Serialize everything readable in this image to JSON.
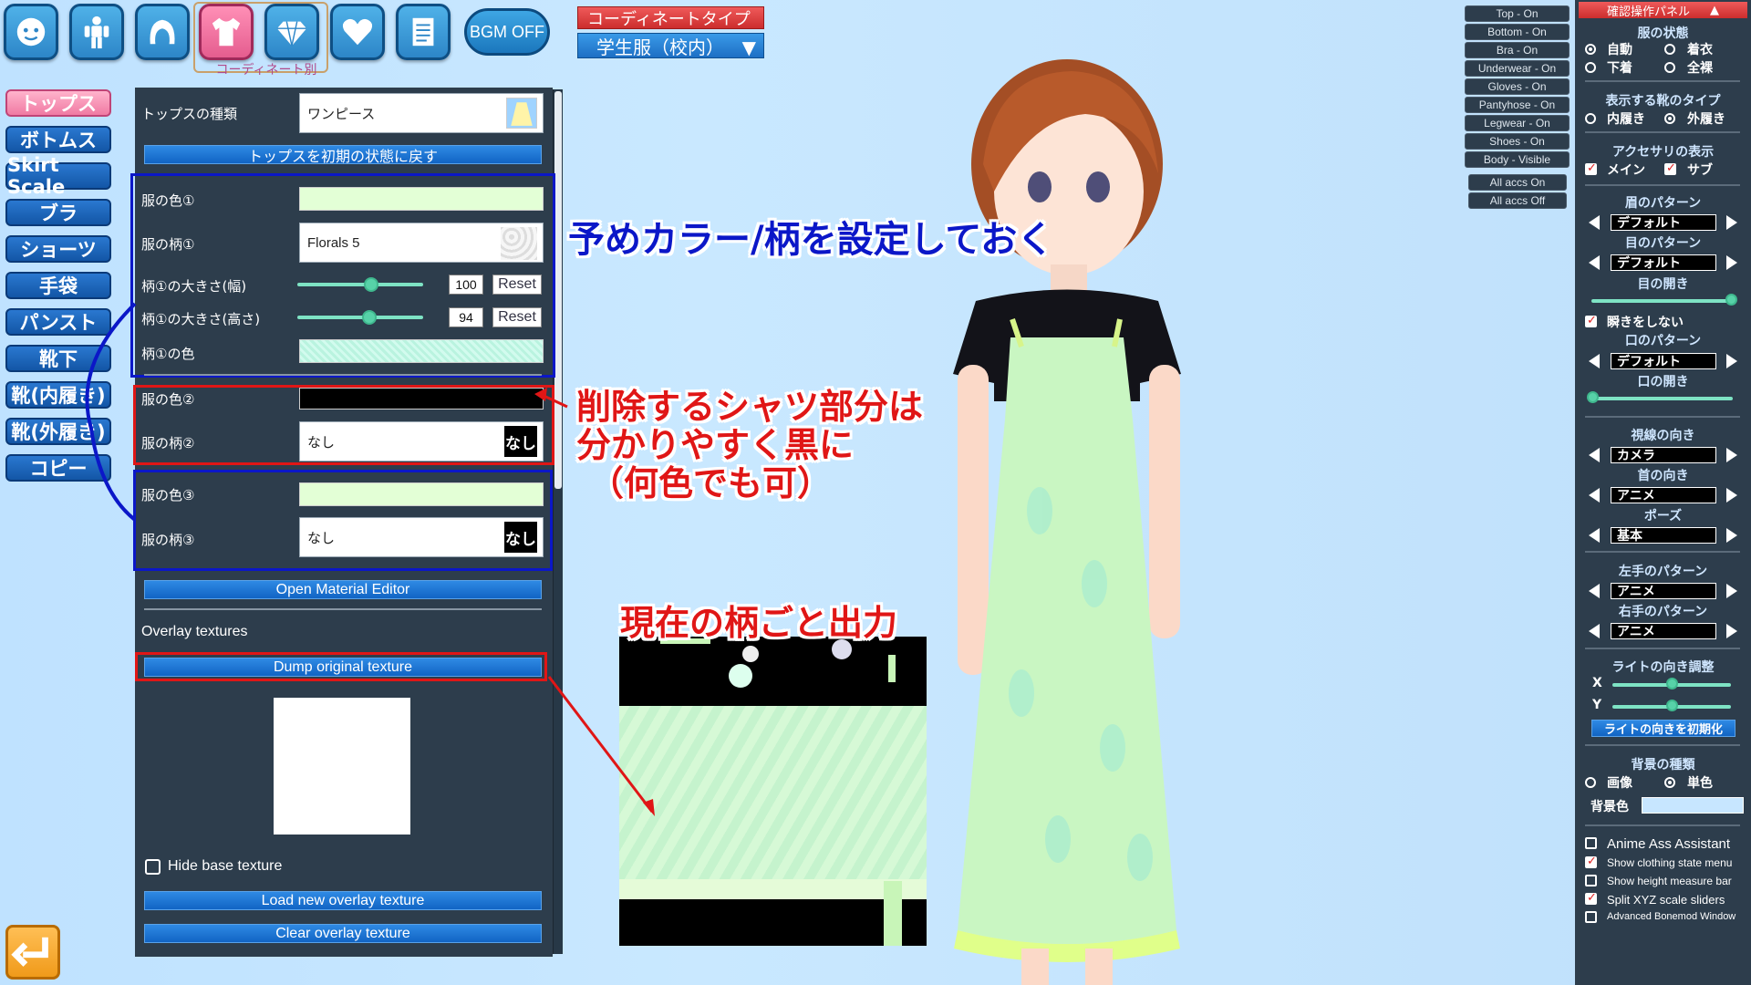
{
  "top_icons": [
    "face-icon",
    "body-icon",
    "hair-icon",
    "clothing-icon",
    "accessory-icon",
    "heart-icon",
    "document-icon"
  ],
  "top_icons_label": "コーディネート別",
  "bgm_label": "BGM OFF",
  "categories": [
    "トップス",
    "ボトムス",
    "Skirt Scale",
    "ブラ",
    "ショーツ",
    "手袋",
    "パンスト",
    "靴下",
    "靴(内履き)",
    "靴(外履き)",
    "コピー"
  ],
  "coordinate": {
    "title": "コーディネートタイプ",
    "selected": "学生服（校内）",
    "arrow": "▼"
  },
  "panel": {
    "tops_type_label": "トップスの種類",
    "tops_type_value": "ワンピース",
    "reset_tops": "トップスを初期の状態に戻す",
    "color1": "服の色①",
    "pattern1": "服の柄①",
    "pattern1_value": "Florals 5",
    "size_w": "柄①の大きさ(幅)",
    "size_w_value": "100",
    "size_h": "柄①の大きさ(高さ)",
    "size_h_value": "94",
    "reset": "Reset",
    "pattern1_color": "柄①の色",
    "color2": "服の色②",
    "pattern2": "服の柄②",
    "pattern2_value": "なし",
    "color3": "服の色③",
    "pattern3": "服の柄③",
    "pattern3_value": "なし",
    "nashi": "なし",
    "open_material": "Open Material Editor",
    "overlay_label": "Overlay textures",
    "dump": "Dump original texture",
    "hide_base": "Hide base texture",
    "load_overlay": "Load new overlay texture",
    "clear_overlay": "Clear overlay texture",
    "slider_w": 0.6,
    "slider_h": 0.57
  },
  "annotations": {
    "a1": "予めカラー/柄を設定しておく",
    "a2_l1": "削除するシャツ部分は",
    "a2_l2": "分かりやすく黒に",
    "a2_l3": "（何色でも可）",
    "a3": "現在の柄ごと出力"
  },
  "toggles": [
    "Top - On",
    "Bottom - On",
    "Bra - On",
    "Underwear - On",
    "Gloves - On",
    "Pantyhose - On",
    "Legwear - On",
    "Shoes - On",
    "Body - Visible",
    "All accs On",
    "All accs Off"
  ],
  "right": {
    "title": "確認操作パネル",
    "title_arrow": "▲",
    "clothing_state": "服の状態",
    "auto": "自動",
    "dressed": "着衣",
    "underwear": "下着",
    "nude": "全裸",
    "shoe_type": "表示する靴のタイプ",
    "indoor": "内履き",
    "outdoor": "外履き",
    "accessory": "アクセサリの表示",
    "main": "メイン",
    "sub": "サブ",
    "brow": "眉のパターン",
    "eye": "目のパターン",
    "default": "デフォルト",
    "eye_open": "目の開き",
    "no_blink": "瞬きをしない",
    "mouth": "口のパターン",
    "mouth_open": "口の開き",
    "gaze": "視線の向き",
    "gaze_value": "カメラ",
    "neck": "首の向き",
    "neck_value": "アニメ",
    "pose": "ポーズ",
    "pose_value": "基本",
    "left_hand": "左手のパターン",
    "left_hand_value": "アニメ",
    "right_hand": "右手のパターン",
    "right_hand_value": "アニメ",
    "light": "ライトの向き調整",
    "x": "X",
    "y": "Y",
    "light_reset": "ライトの向きを初期化",
    "bg_type": "背景の種類",
    "image": "画像",
    "solid": "単色",
    "bg_color": "背景色",
    "anime_ass": "Anime Ass Assistant",
    "show_clothing": "Show clothing state menu",
    "show_height": "Show height measure bar",
    "split_xyz": "Split XYZ scale sliders",
    "advanced_bonemod": "Advanced Bonemod Window",
    "eye_open_level": 0.98,
    "mouth_open_level": 0.0,
    "light_x": 0.5,
    "light_y": 0.5
  },
  "colors": {
    "accent_blue": "#1a6fd0",
    "accent_pink": "#f07aa3",
    "highlight_blue": "#0b17c8",
    "highlight_red": "#e01616",
    "dress_green": "#c8f5b8",
    "bg_sky": "#c7e6ff"
  }
}
